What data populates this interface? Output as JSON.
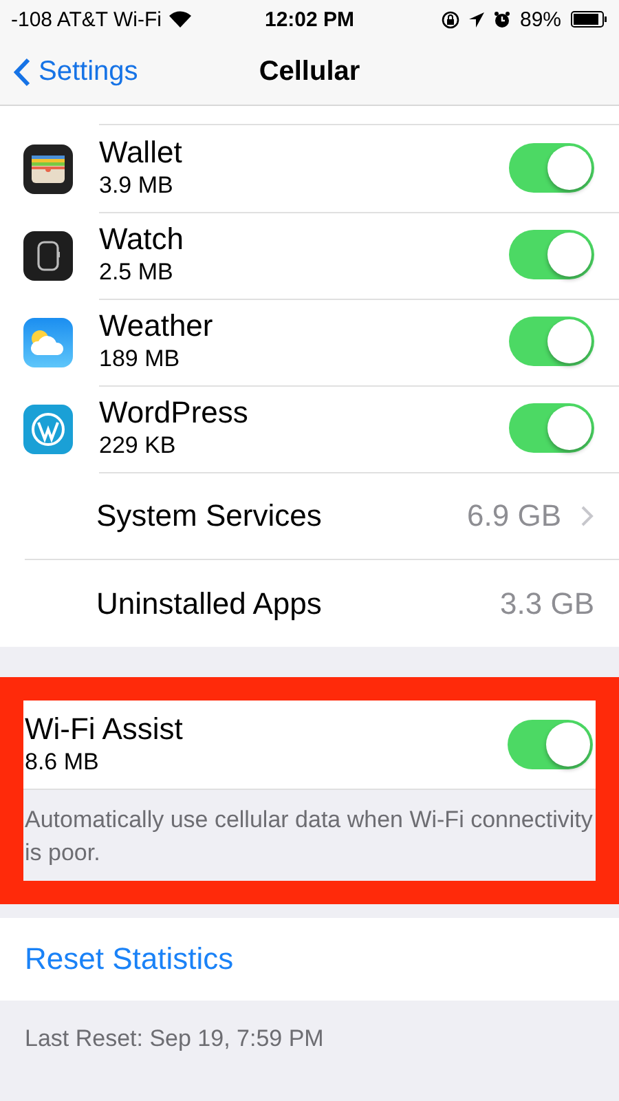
{
  "status_bar": {
    "carrier": "-108 AT&T Wi-Fi",
    "time": "12:02 PM",
    "battery": "89%"
  },
  "nav": {
    "back": "Settings",
    "title": "Cellular"
  },
  "apps": [
    {
      "name": "Wallet",
      "usage": "3.9 MB",
      "on": true
    },
    {
      "name": "Watch",
      "usage": "2.5 MB",
      "on": true
    },
    {
      "name": "Weather",
      "usage": "189 MB",
      "on": true
    },
    {
      "name": "WordPress",
      "usage": "229 KB",
      "on": true
    }
  ],
  "totals": [
    {
      "label": "System Services",
      "value": "6.9 GB",
      "chevron": true
    },
    {
      "label": "Uninstalled Apps",
      "value": "3.3 GB",
      "chevron": false
    }
  ],
  "wifi_assist": {
    "label": "Wi-Fi Assist",
    "usage": "8.6 MB",
    "on": true,
    "highlighted": true,
    "footer": "Automatically use cellular data when Wi-Fi connectivity is poor."
  },
  "reset": {
    "label": "Reset Statistics",
    "footer": "Last Reset: Sep 19, 7:59 PM"
  }
}
